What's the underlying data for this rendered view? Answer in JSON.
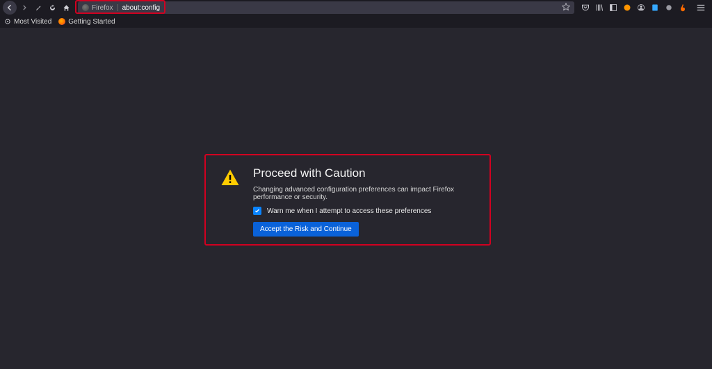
{
  "toolbar": {
    "url_prefix": "Firefox",
    "url": "about:config"
  },
  "bookmarks": {
    "most_visited": "Most Visited",
    "getting_started": "Getting Started"
  },
  "dialog": {
    "title": "Proceed with Caution",
    "description": "Changing advanced configuration preferences can impact Firefox performance or security.",
    "checkbox_label": "Warn me when I attempt to access these preferences",
    "accept_button": "Accept the Risk and Continue"
  }
}
